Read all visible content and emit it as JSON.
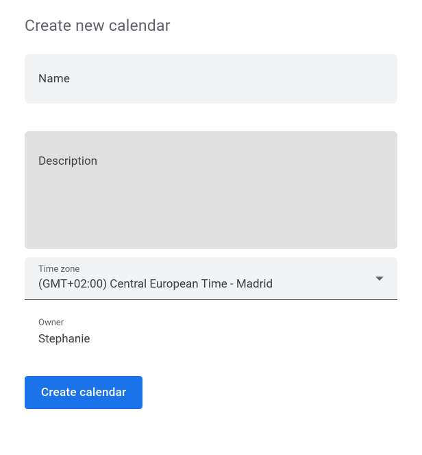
{
  "title": "Create new calendar",
  "fields": {
    "name": {
      "label": "Name"
    },
    "description": {
      "label": "Description"
    },
    "timezone": {
      "label": "Time zone",
      "value": "(GMT+02:00) Central European Time - Madrid"
    },
    "owner": {
      "label": "Owner",
      "value": "Stephanie"
    }
  },
  "actions": {
    "create": "Create calendar"
  }
}
